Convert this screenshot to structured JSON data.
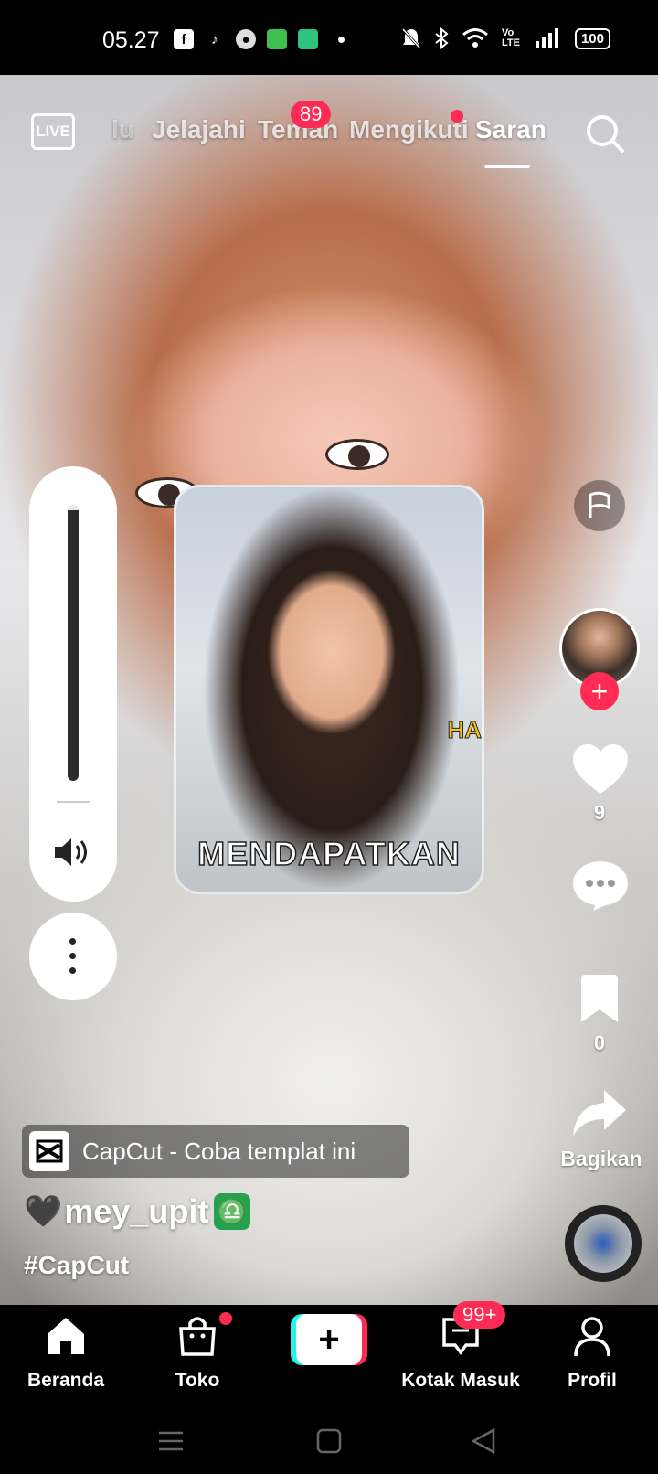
{
  "status_bar": {
    "time": "05.27",
    "battery": "100",
    "network_label": "Vo LTE",
    "icons": [
      "facebook-icon",
      "tiktok-icon",
      "app-icon",
      "message-icon",
      "battery-saver-icon",
      "mute-icon",
      "bluetooth-icon",
      "wifi-icon",
      "signal-icon"
    ]
  },
  "top_nav": {
    "live_label": "LIVE",
    "tabs": [
      {
        "label": "lu"
      },
      {
        "label": "Jelajahi"
      },
      {
        "label": "Teman",
        "badge": "89"
      },
      {
        "label": "Mengikuti"
      },
      {
        "label": "Saran",
        "active": true
      }
    ]
  },
  "pip": {
    "caption": "MENDAPATKAN",
    "side_text": "HA"
  },
  "right_rail": {
    "likes": "9",
    "bookmarks": "0",
    "share_label": "Bagikan",
    "follow_symbol": "+"
  },
  "volume": {
    "level": 0.98
  },
  "caption": {
    "capcut_text": "CapCut - Coba templat ini",
    "heart": "🖤",
    "username": "mey_upit",
    "zodiac": "♎",
    "hashtag": "#CapCut"
  },
  "bottom_nav": {
    "items": [
      {
        "label": "Beranda",
        "icon": "home-icon",
        "active": true
      },
      {
        "label": "Toko",
        "icon": "shop-icon"
      },
      {
        "label": "Kotak Masuk",
        "icon": "inbox-icon",
        "badge": "99+"
      },
      {
        "label": "Profil",
        "icon": "profile-icon"
      }
    ],
    "create_symbol": "+"
  },
  "colors": {
    "accent": "#fe2c55",
    "cyan": "#25f4ee"
  }
}
